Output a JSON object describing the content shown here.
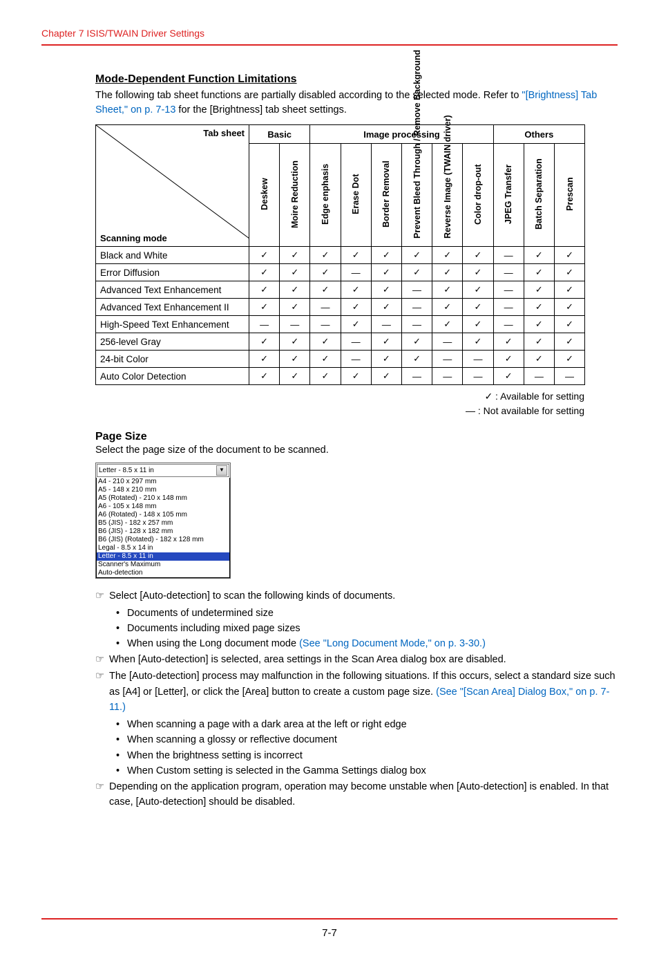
{
  "header": "Chapter 7   ISIS/TWAIN Driver Settings",
  "section_title": "Mode-Dependent Function Limitations",
  "intro_pre": "The following tab sheet functions are partially disabled according to the selected mode. Refer to ",
  "intro_link": "\"[Brightness] Tab Sheet,\" on p. 7-13",
  "intro_post": " for the [Brightness] tab sheet settings.",
  "table": {
    "tab_sheet": "Tab sheet",
    "scanning_mode": "Scanning mode",
    "groups": [
      {
        "label": "Basic",
        "span": 2
      },
      {
        "label": "Image processing",
        "span": 6
      },
      {
        "label": "Others",
        "span": 3
      }
    ],
    "cols": [
      "Deskew",
      "Moire Reduction",
      "Edge enphasis",
      "Erase Dot",
      "Border Removal",
      "Prevent Bleed Through / Remove Background",
      "Reverse Image (TWAIN driver)",
      "Color drop-out",
      "JPEG Transfer",
      "Batch Separation",
      "Prescan"
    ],
    "rows": [
      {
        "label": "Black and White",
        "v": [
          1,
          1,
          1,
          1,
          1,
          1,
          1,
          1,
          0,
          1,
          1
        ]
      },
      {
        "label": "Error Diffusion",
        "v": [
          1,
          1,
          1,
          0,
          1,
          1,
          1,
          1,
          0,
          1,
          1
        ]
      },
      {
        "label": "Advanced Text Enhancement",
        "v": [
          1,
          1,
          1,
          1,
          1,
          0,
          1,
          1,
          0,
          1,
          1
        ]
      },
      {
        "label": "Advanced Text Enhancement II",
        "v": [
          1,
          1,
          0,
          1,
          1,
          0,
          1,
          1,
          0,
          1,
          1
        ]
      },
      {
        "label": "High-Speed Text Enhancement",
        "v": [
          0,
          0,
          0,
          1,
          0,
          0,
          1,
          1,
          0,
          1,
          1
        ]
      },
      {
        "label": "256-level Gray",
        "v": [
          1,
          1,
          1,
          0,
          1,
          1,
          0,
          1,
          1,
          1,
          1
        ]
      },
      {
        "label": "24-bit Color",
        "v": [
          1,
          1,
          1,
          0,
          1,
          1,
          0,
          0,
          1,
          1,
          1
        ]
      },
      {
        "label": "Auto Color Detection",
        "v": [
          1,
          1,
          1,
          1,
          1,
          0,
          0,
          0,
          1,
          0,
          0
        ]
      }
    ]
  },
  "legend_avail": "✓ : Available for setting",
  "legend_notavail": "— : Not available for setting",
  "pagesize": {
    "heading": "Page Size",
    "desc": "Select the page size of the document to be scanned.",
    "selected": "Letter - 8.5 x 11 in",
    "options": [
      "A4 - 210 x 297 mm",
      "A5 - 148 x 210 mm",
      "A5 (Rotated) - 210 x 148 mm",
      "A6 - 105 x 148 mm",
      "A6 (Rotated) - 148 x 105 mm",
      "B5 (JIS) - 182 x 257 mm",
      "B6 (JIS) - 128 x 182 mm",
      "B6 (JIS) (Rotated) - 182 x 128 mm",
      "Legal - 8.5 x 14 in",
      "Letter - 8.5 x 11 in",
      "Scanner's Maximum",
      "Auto-detection"
    ],
    "highlight_index": 9
  },
  "notes": [
    {
      "text": "Select [Auto-detection] to scan the following kinds of documents.",
      "subs": [
        {
          "text": "Documents of undetermined size"
        },
        {
          "text": "Documents including mixed page sizes"
        },
        {
          "text": "When using the Long document mode ",
          "link": "(See \"Long Document Mode,\" on p. 3-30.)"
        }
      ]
    },
    {
      "text": "When [Auto-detection] is selected, area settings in the Scan Area dialog box are disabled."
    },
    {
      "text": "The [Auto-detection] process may malfunction in the following situations. If this occurs, select a standard size such as [A4] or [Letter], or click the [Area] button to create a custom page size. ",
      "link": "(See \"[Scan Area] Dialog Box,\" on p. 7-11.)",
      "subs": [
        {
          "text": "When scanning a page with a dark area at the left or right edge"
        },
        {
          "text": "When scanning a glossy or reflective document"
        },
        {
          "text": "When the brightness setting is incorrect"
        },
        {
          "text": "When Custom setting is selected in the Gamma Settings dialog box"
        }
      ]
    },
    {
      "text": "Depending on the application program, operation may become unstable when [Auto-detection] is enabled. In that case, [Auto-detection] should be disabled."
    }
  ],
  "page_number": "7-7"
}
